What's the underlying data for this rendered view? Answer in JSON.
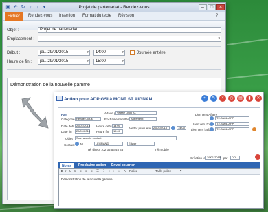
{
  "outlook": {
    "window_title": "Projet de partenariat - Rendez-vous",
    "tabs": [
      "Fichier",
      "Rendez-vous",
      "Insertion",
      "Format du texte",
      "Révision"
    ],
    "fields": {
      "objet_label": "Objet :",
      "objet_value": "Projet de partenariat",
      "emplacement_label": "Emplacement :",
      "debut_label": "Début :",
      "debut_date": "jeu. 29/01/2015",
      "debut_time": "14:00",
      "journee_label": "Journée entière",
      "fin_label": "Heure de fin :",
      "fin_date": "jeu. 29/01/2015",
      "fin_time": "15:00"
    },
    "body_text": "Démonstration de la nouvelle gamme"
  },
  "crm": {
    "title": "Action pour ADP GSI à MONT ST AIGNAN",
    "labels": {
      "part": "Part",
      "a_faire_par": "A faire par",
      "a_faire_par_value": "Valérie DOR AL",
      "categorie": "Catégorie",
      "categorie_value": "Rendez-vous",
      "enchainement": "Enchainement/tâche",
      "enchainement_value": "Autrement",
      "date_debut": "Date début",
      "date_debut_value": "29/01/2015",
      "heure_debut": "Heure début",
      "heure_debut_value": "14:00",
      "alerter": "Alerter prévue le",
      "alerter_value": "29/01/2015",
      "alerter_time": "14:00",
      "date_fin": "Date fin",
      "date_fin_value": "29/01/2015",
      "heure_fin": "Heure fin",
      "heure_fin_value": "15:00",
      "objet": "Objet",
      "objet_value": "Suivi avec le contact",
      "contact": "Contact",
      "contact_m": "M.",
      "contact_name": "LEGRAND",
      "contact_first": "Edwar",
      "tel_direct": "Tél direct : 02 35 56 45 45",
      "tel_mobile": "Tél mobile :",
      "lien_affaire": "Lien vers Affaire",
      "lien_affaire_value": "T2-BN08-APP",
      "lien_offre": "Lien vers l'offre",
      "lien_offre_value": "T2-BN08-APP",
      "lien_affaire2": "Lien vers l'affaire",
      "lien_affaire2_value": "T2-BN08-APP",
      "creation": "Création le",
      "creation_value": "29/01/2015",
      "par": "par",
      "par_value": "DOL"
    },
    "tabs": [
      "Notes",
      "Prochaine action",
      "Envoi courrier"
    ],
    "toolbar": {
      "bold": "B",
      "italic": "I",
      "underline": "U",
      "strike": "S",
      "font": "Police",
      "size": "Taille police"
    },
    "notes_text": "Démonstration de la nouvelle gamme"
  },
  "colors": {
    "file_tab": "#e57724",
    "crm_blue": "#2f66b3",
    "desktop_green": "#3a9f48"
  }
}
